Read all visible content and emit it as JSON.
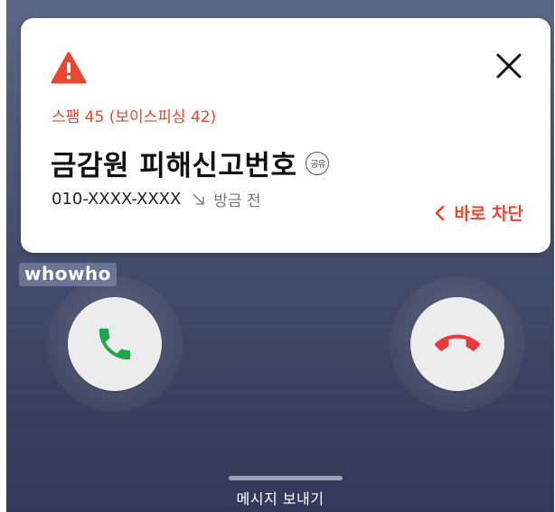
{
  "alert": {
    "icon": "warning-triangle-icon",
    "spam_label": "스팸 45 (보이스피싱 42)",
    "caller_name": "금감원 피해신고번호",
    "shared_badge": "공유",
    "phone_number": "010-XXXX-XXXX",
    "call_direction_icon": "incoming-arrow-icon",
    "call_time": "방금 전",
    "block_label": "바로 차단",
    "close_icon": "close-icon"
  },
  "brand": {
    "name": "whowho"
  },
  "call_controls": {
    "accept_icon": "phone-accept-icon",
    "decline_icon": "phone-decline-icon"
  },
  "footer": {
    "message_label": "메시지 보내기"
  },
  "colors": {
    "accent_red": "#e8472f",
    "accept_green": "#1fa54a",
    "decline_red": "#e63c3c"
  }
}
